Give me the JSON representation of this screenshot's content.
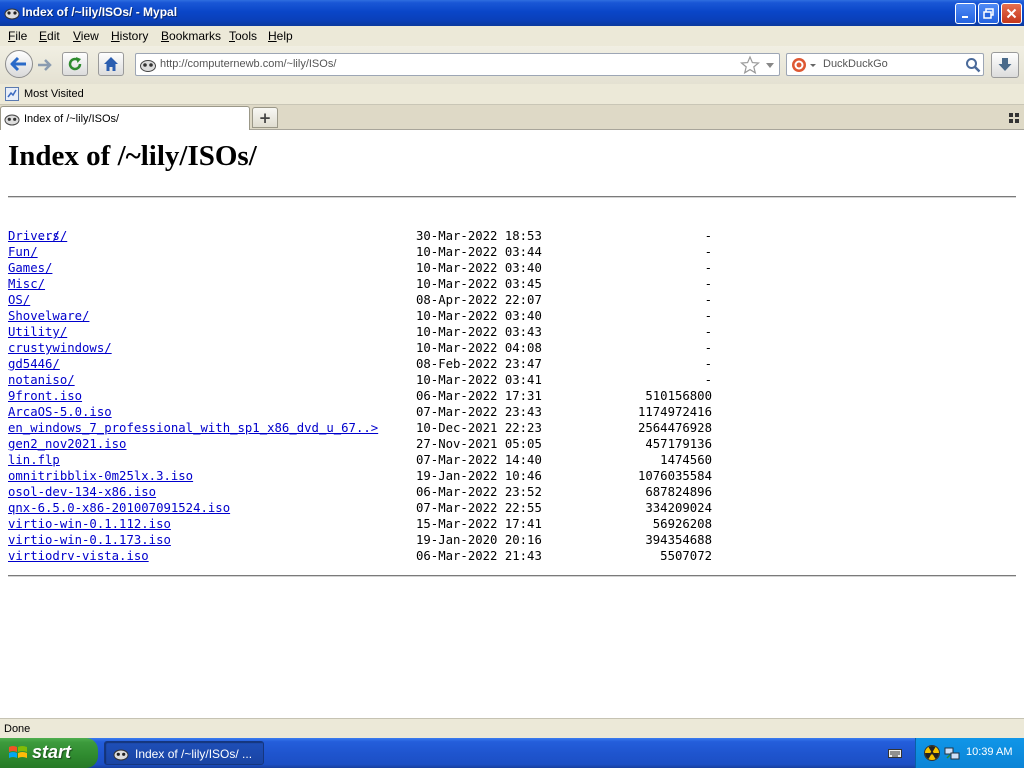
{
  "window": {
    "title": "Index of /~lily/ISOs/ - Mypal"
  },
  "menu": [
    "File",
    "Edit",
    "View",
    "History",
    "Bookmarks",
    "Tools",
    "Help"
  ],
  "navbar": {
    "url": "http://computernewb.com/~lily/ISOs/",
    "search_placeholder": "DuckDuckGo"
  },
  "bookmarks": {
    "most_visited": "Most Visited"
  },
  "tabs": [
    {
      "label": "Index of /~lily/ISOs/"
    }
  ],
  "page": {
    "heading": "Index of /~lily/ISOs/",
    "parent_link": "../",
    "entries": [
      {
        "name": "Drivers/",
        "date": "30-Mar-2022 18:53",
        "size": "-"
      },
      {
        "name": "Fun/",
        "date": "10-Mar-2022 03:44",
        "size": "-"
      },
      {
        "name": "Games/",
        "date": "10-Mar-2022 03:40",
        "size": "-"
      },
      {
        "name": "Misc/",
        "date": "10-Mar-2022 03:45",
        "size": "-"
      },
      {
        "name": "OS/",
        "date": "08-Apr-2022 22:07",
        "size": "-"
      },
      {
        "name": "Shovelware/",
        "date": "10-Mar-2022 03:40",
        "size": "-"
      },
      {
        "name": "Utility/",
        "date": "10-Mar-2022 03:43",
        "size": "-"
      },
      {
        "name": "crustywindows/",
        "date": "10-Mar-2022 04:08",
        "size": "-"
      },
      {
        "name": "gd5446/",
        "date": "08-Feb-2022 23:47",
        "size": "-"
      },
      {
        "name": "notaniso/",
        "date": "10-Mar-2022 03:41",
        "size": "-"
      },
      {
        "name": "9front.iso",
        "date": "06-Mar-2022 17:31",
        "size": "510156800"
      },
      {
        "name": "ArcaOS-5.0.iso",
        "date": "07-Mar-2022 23:43",
        "size": "1174972416"
      },
      {
        "name": "en_windows_7_professional_with_sp1_x86_dvd_u_67..>",
        "date": "10-Dec-2021 22:23",
        "size": "2564476928"
      },
      {
        "name": "gen2_nov2021.iso",
        "date": "27-Nov-2021 05:05",
        "size": "457179136"
      },
      {
        "name": "lin.flp",
        "date": "07-Mar-2022 14:40",
        "size": "1474560"
      },
      {
        "name": "omnitribblix-0m25lx.3.iso",
        "date": "19-Jan-2022 10:46",
        "size": "1076035584"
      },
      {
        "name": "osol-dev-134-x86.iso",
        "date": "06-Mar-2022 23:52",
        "size": "687824896"
      },
      {
        "name": "qnx-6.5.0-x86-201007091524.iso",
        "date": "07-Mar-2022 22:55",
        "size": "334209024"
      },
      {
        "name": "virtio-win-0.1.112.iso",
        "date": "15-Mar-2022 17:41",
        "size": "56926208"
      },
      {
        "name": "virtio-win-0.1.173.iso",
        "date": "19-Jan-2020 20:16",
        "size": "394354688"
      },
      {
        "name": "virtiodrv-vista.iso",
        "date": "06-Mar-2022 21:43",
        "size": "5507072"
      }
    ]
  },
  "status": {
    "text": "Done"
  },
  "taskbar": {
    "start_label": "start",
    "window_button": "Index of /~lily/ISOs/ ...",
    "clock": "10:39 AM"
  },
  "colors": {
    "link": "#0000cc",
    "titlebar": "#0a46c8",
    "taskbar": "#1f55cf",
    "start_button": "#3c9a3c",
    "chrome": "#ece9d8"
  },
  "icons": {
    "app": "mypal-icon",
    "back": "back-arrow-icon",
    "forward": "forward-arrow-icon",
    "reload": "reload-icon",
    "home": "home-icon",
    "site": "site-identity-icon",
    "bookmark_star": "star-icon",
    "search_engine": "duckduckgo-icon",
    "search": "magnifier-icon",
    "downloads": "download-icon",
    "most_visited": "most-visited-icon",
    "new_tab": "plus-icon",
    "all_tabs": "list-all-tabs-icon",
    "windows_flag": "windows-flag-icon",
    "keyboard": "keyboard-icon",
    "radiation": "radiation-tray-icon",
    "network": "network-tray-icon"
  }
}
